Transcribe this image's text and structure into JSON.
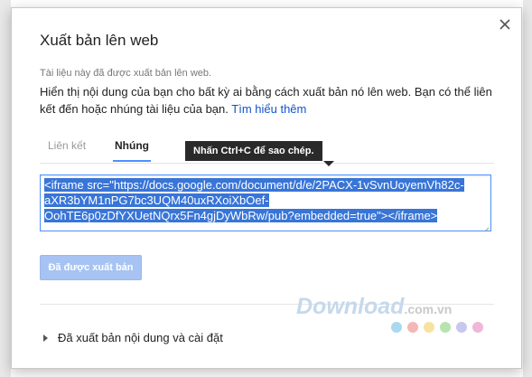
{
  "dialog": {
    "title": "Xuất bản lên web",
    "subtitle": "Tài liệu này đã được xuất bản lên web.",
    "description": "Hiển thị nội dung của bạn cho bất kỳ ai bằng cách xuất bản nó lên web. Bạn có thể liên kết đến hoặc nhúng tài liệu của bạn.",
    "learn_more": "Tìm hiểu thêm",
    "close_icon": "close-icon"
  },
  "tabs": [
    {
      "label": "Liên kết",
      "active": false
    },
    {
      "label": "Nhúng",
      "active": true
    }
  ],
  "tooltip": "Nhấn Ctrl+C để sao chép.",
  "embed": {
    "lines": [
      "<iframe src=\"https://docs.google.com/document/d/e/2PACX-1vSvnUoyemVh82c-",
      "aXR3bYM1nPG7bc3UQM40uxRXoiXbOef-",
      "OohTE6p0zDfYXUetNQrx5Fn4gjDyWbRw/pub?embedded=true\"></iframe>"
    ]
  },
  "published_button": "Đã được xuất bản",
  "expander": "Đã xuất bản nội dung và cài đặt",
  "watermark": {
    "brand": "Download",
    "suffix": ".com.vn"
  },
  "colors": {
    "accent": "#4d90fe",
    "selection": "#3875d7",
    "link": "#1155cc",
    "disabled_button": "#a6c3f3",
    "tooltip_bg": "#2a2a2a",
    "dot_colors": [
      "#a9d8ef",
      "#f4b6b6",
      "#f7e3a1",
      "#b8e3b0",
      "#c7c7f0",
      "#f0b7d6"
    ]
  }
}
